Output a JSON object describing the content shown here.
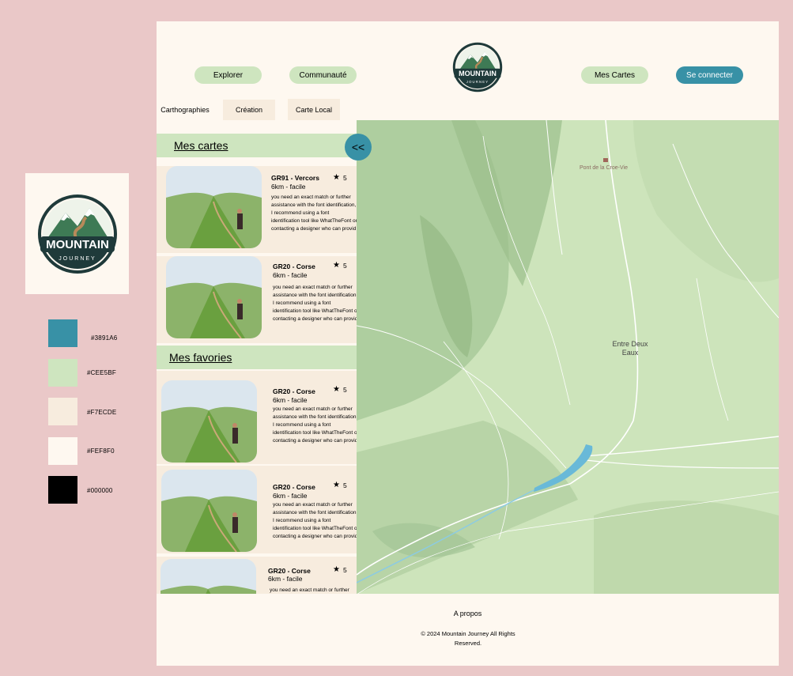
{
  "styleguide": {
    "colors": [
      {
        "hex": "#3891a6",
        "label": "#3891A6"
      },
      {
        "hex": "#cee5bf",
        "label": "#CEE5BF"
      },
      {
        "hex": "#f7ecde",
        "label": "#F7ECDE"
      },
      {
        "hex": "#fef8f0",
        "label": "#FEF8F0"
      },
      {
        "hex": "#000000",
        "label": "#000000"
      }
    ]
  },
  "logo": {
    "main": "MOUNTAIN",
    "sub": "JOURNEY"
  },
  "nav": {
    "explorer": "Explorer",
    "communaute": "Communauté",
    "mes_cartes": "Mes Cartes",
    "login": "Se connecter"
  },
  "tabs": [
    "Carthographies",
    "Création",
    "Carte Local"
  ],
  "panel": {
    "collapse_label": "<<",
    "mes_cartes_title": "Mes cartes",
    "favoris_title": "Mes favories",
    "mes_cartes": [
      {
        "title": "GR91 - Vercors",
        "subtitle": "6km - facile",
        "rating": "5",
        "desc": "you need an exact match or further assistance with the font identification, I recommend using a font identification tool like WhatTheFont or contacting a designer who can provid"
      },
      {
        "title": "GR20 - Corse",
        "subtitle": "6km - facile",
        "rating": "5",
        "desc": " you need an exact match or further assistance with the font identification, I recommend using a font identification tool like WhatTheFont or contacting a designer who can provid"
      }
    ],
    "favoris": [
      {
        "title": "GR20 - Corse",
        "subtitle": "6km - facile",
        "rating": "5",
        "desc": " you need an exact match or further assistance with the font identification, I recommend using a font identification tool like WhatTheFont or contacting a designer who can provid"
      },
      {
        "title": "GR20 - Corse",
        "subtitle": "6km - facile",
        "rating": "5",
        "desc": " you need an exact match or further assistance with the font identification, I recommend using a font identification tool like WhatTheFont or contacting a designer who can provid"
      },
      {
        "title": "GR20 - Corse",
        "subtitle": "6km - facile",
        "rating": "5",
        "desc": "you need an exact match or further"
      }
    ]
  },
  "map": {
    "place1": "Pont de la Croe-Vie",
    "place2_line1": "Entre Deux",
    "place2_line2": "Eaux"
  },
  "footer": {
    "about": "A propos",
    "copyright": "© 2024 Mountain Journey All Rights Reserved."
  }
}
